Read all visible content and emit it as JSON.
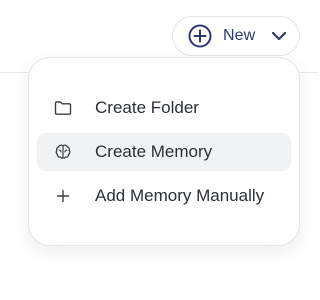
{
  "header": {
    "new_button": {
      "label": "New",
      "icon": "plus-circle-icon",
      "dropdown_icon": "chevron-down-icon"
    }
  },
  "menu": {
    "items": [
      {
        "label": "Create Folder",
        "icon": "folder-icon",
        "highlighted": false
      },
      {
        "label": "Create Memory",
        "icon": "brain-icon",
        "highlighted": true
      },
      {
        "label": "Add Memory Manually",
        "icon": "plus-icon",
        "highlighted": false
      }
    ]
  },
  "colors": {
    "accent": "#2d3a6b",
    "highlight": "#f1f2f4",
    "border": "#e2e5ea"
  }
}
